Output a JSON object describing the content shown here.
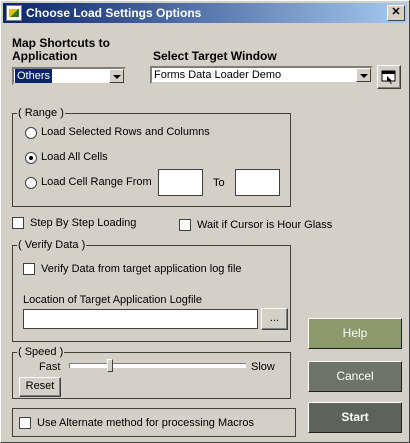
{
  "window": {
    "title": "Choose Load Settings Options",
    "close_label": "✕"
  },
  "map_shortcuts": {
    "label_line1": "Map Shortcuts to",
    "label_line2": "Application",
    "selected": "Others"
  },
  "target_window": {
    "label": "Select Target Window",
    "selected": "Forms Data Loader Demo"
  },
  "range": {
    "legend": "( Range )",
    "options": [
      {
        "label": "Load Selected Rows and Columns",
        "checked": false
      },
      {
        "label": "Load All Cells",
        "checked": true
      },
      {
        "label": "Load Cell Range From",
        "checked": false
      }
    ],
    "from_value": "",
    "to_label": "To",
    "to_value": ""
  },
  "step_by_step": {
    "label": "Step By Step Loading",
    "checked": false
  },
  "wait_cursor": {
    "label": "Wait if Cursor is Hour Glass",
    "checked": false
  },
  "verify": {
    "legend": "( Verify Data )",
    "checkbox_label": "Verify Data from target application log file",
    "checked": false,
    "logfile_label": "Location of Target Application Logfile",
    "logfile_value": "",
    "browse_label": "..."
  },
  "speed": {
    "legend": "( Speed )",
    "fast_label": "Fast",
    "slow_label": "Slow",
    "level": 0.22,
    "reset_label": "Reset"
  },
  "alt_macros": {
    "label": "Use Alternate method for processing Macros",
    "checked": false
  },
  "buttons": {
    "help": "Help",
    "cancel": "Cancel",
    "start": "Start",
    "help_color": "#8a9a6a",
    "cancel_color": "#6f7468",
    "start_color": "#5e635a"
  }
}
